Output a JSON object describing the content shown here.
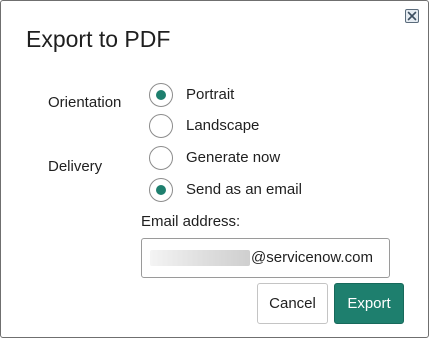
{
  "dialog": {
    "title": "Export to PDF",
    "close_icon": "close-x-icon"
  },
  "orientation": {
    "label": "Orientation",
    "options": [
      {
        "label": "Portrait",
        "checked": true
      },
      {
        "label": "Landscape",
        "checked": false
      }
    ]
  },
  "delivery": {
    "label": "Delivery",
    "options": [
      {
        "label": "Generate now",
        "checked": false
      },
      {
        "label": "Send as an email",
        "checked": true
      }
    ]
  },
  "email": {
    "label": "Email address:",
    "domain": "@servicenow.com"
  },
  "buttons": {
    "cancel": "Cancel",
    "export": "Export"
  },
  "colors": {
    "accent": "#1e7f6e",
    "border": "#6f6f6f"
  }
}
